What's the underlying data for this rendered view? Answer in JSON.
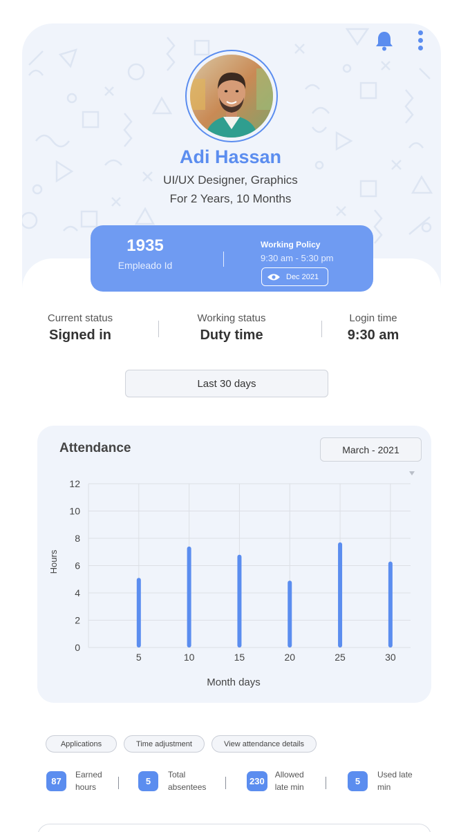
{
  "profile": {
    "name": "Adi Hassan",
    "role": "UI/UX Designer, Graphics",
    "tenure": "For 2 Years, 10 Months"
  },
  "employee": {
    "id": "1935",
    "id_label": "Empleado Id",
    "policy_title": "Working Policy",
    "policy_hours": "9:30 am - 5:30 pm",
    "policy_date": "Dec 2021"
  },
  "status": [
    {
      "label": "Current status",
      "value": "Signed in"
    },
    {
      "label": "Working status",
      "value": "Duty time"
    },
    {
      "label": "Login time",
      "value": "9:30 am"
    }
  ],
  "range_button": "Last 30 days",
  "attendance": {
    "title": "Attendance",
    "month_select": "March - 2021"
  },
  "chart_data": {
    "type": "bar",
    "xlabel": "Month days",
    "ylabel": "Hours",
    "x_ticks": [
      5,
      10,
      15,
      20,
      25,
      30
    ],
    "y_ticks": [
      0,
      2,
      4,
      6,
      8,
      10,
      12
    ],
    "xlim": [
      0,
      32
    ],
    "ylim": [
      0,
      12
    ],
    "grid": true,
    "series": [
      {
        "values": [
          {
            "x": 5,
            "y": 5.1
          },
          {
            "x": 10,
            "y": 7.4
          },
          {
            "x": 15,
            "y": 6.8
          },
          {
            "x": 20,
            "y": 4.9
          },
          {
            "x": 25,
            "y": 7.7
          },
          {
            "x": 30,
            "y": 6.3
          }
        ]
      }
    ],
    "color": "#5b8def"
  },
  "chips": [
    "Applications",
    "Time adjustment",
    "View attendance details"
  ],
  "metrics": [
    {
      "value": "87",
      "label": "Earned hours"
    },
    {
      "value": "5",
      "label": "Total absentees"
    },
    {
      "value": "230",
      "label": "Allowed late min"
    },
    {
      "value": "5",
      "label": "Used late min"
    }
  ],
  "icons": {
    "notification": "bell-icon",
    "menu": "more-vertical-icon",
    "view": "eye-icon"
  },
  "colors": {
    "accent": "#5b8def",
    "card": "#6f9bf2",
    "surface": "#f0f4fb"
  }
}
